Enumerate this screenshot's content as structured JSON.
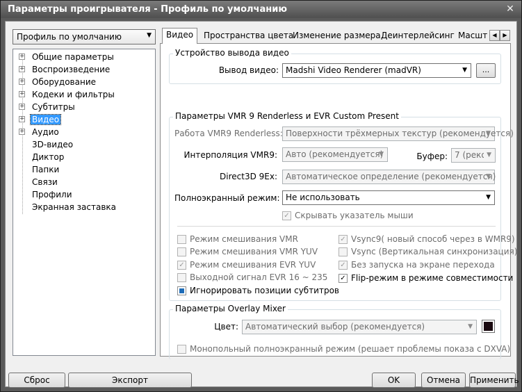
{
  "window": {
    "title": "Параметры проигрывателя - Профиль по умолчанию",
    "close_glyph": "✕"
  },
  "profile": {
    "selected": "Профиль по умолчанию"
  },
  "tree": {
    "items": [
      {
        "label": "Общие параметры",
        "expandable": true
      },
      {
        "label": "Воспроизведение",
        "expandable": true
      },
      {
        "label": "Оборудование",
        "expandable": true
      },
      {
        "label": "Кодеки и фильтры",
        "expandable": true
      },
      {
        "label": "Субтитры",
        "expandable": true
      },
      {
        "label": "Видео",
        "expandable": true,
        "selected": true
      },
      {
        "label": "Аудио",
        "expandable": true
      },
      {
        "label": "3D-видео",
        "expandable": false
      },
      {
        "label": "Диктор",
        "expandable": false
      },
      {
        "label": "Папки",
        "expandable": false
      },
      {
        "label": "Связи",
        "expandable": false
      },
      {
        "label": "Профили",
        "expandable": false
      },
      {
        "label": "Экранная заставка",
        "expandable": false
      }
    ]
  },
  "tabs": {
    "items": [
      {
        "label": "Видео",
        "active": true
      },
      {
        "label": "Пространства цвета"
      },
      {
        "label": "Изменение размера"
      },
      {
        "label": "Деинтерлейсинг"
      },
      {
        "label": "Масшт"
      }
    ],
    "scroll_left": "◀",
    "scroll_right": "▶"
  },
  "output_group": {
    "title": "Устройство вывода видео",
    "output_label": "Вывод видео:",
    "output_value": "Madshi Video Renderer (madVR)",
    "browse_label": "..."
  },
  "vmr_group": {
    "title": "Параметры VMR 9 Renderless и EVR Custom Present",
    "renderless_label": "Работа VMR9 Renderless:",
    "renderless_value": "Поверхности трёхмерных текстур (рекомендуется)",
    "interp_label": "Интерполяция VMR9:",
    "interp_value": "Авто (рекомендуется)",
    "buffer_label": "Буфер:",
    "buffer_value": "7 (реко",
    "d3d_label": "Direct3D 9Ex:",
    "d3d_value": "Автоматическое определение (рекомендуется)",
    "fullscreen_label": "Полноэкранный режим:",
    "fullscreen_value": "Не использовать",
    "hide_cursor_label": "Скрывать указатель мыши",
    "hide_cursor_checked": true,
    "checks_left": [
      {
        "label": "Режим смешивания VMR",
        "checked": false,
        "disabled": true
      },
      {
        "label": "Режим смешивания VMR YUV",
        "checked": false,
        "disabled": true
      },
      {
        "label": "Режим смешивания EVR YUV",
        "checked": true,
        "disabled": true
      },
      {
        "label": "Выходной сигнал EVR 16 ~ 235",
        "checked": false,
        "disabled": true
      },
      {
        "label": "Игнорировать позиции субтитров",
        "checked": "partial",
        "disabled": false
      }
    ],
    "checks_right": [
      {
        "label": "Vsync9( новый способ через в WMR9)",
        "checked": true,
        "disabled": true
      },
      {
        "label": "Vsync (Вертикальная синхронизация)",
        "checked": false,
        "disabled": true
      },
      {
        "label": "Без запуска на экране перехода",
        "checked": true,
        "disabled": true
      },
      {
        "label": "Flip-режим в режиме совместимости",
        "checked": true,
        "disabled": false
      }
    ]
  },
  "overlay_group": {
    "title": "Параметры Overlay Mixer",
    "color_label": "Цвет:",
    "color_value": "Автоматический выбор (рекомендуется)",
    "swatch_color": "#1a0a10",
    "exclusive_label": "Монопольный полноэкранный режим (решает проблемы показа с DXVA)",
    "exclusive_checked": false
  },
  "buttons": {
    "reset": "Сброс",
    "export": "Экспорт",
    "ok": "OK",
    "cancel": "Отмена",
    "apply": "Применить"
  },
  "glyphs": {
    "check": "✓",
    "arrow_down": "▼",
    "plus": "+"
  }
}
